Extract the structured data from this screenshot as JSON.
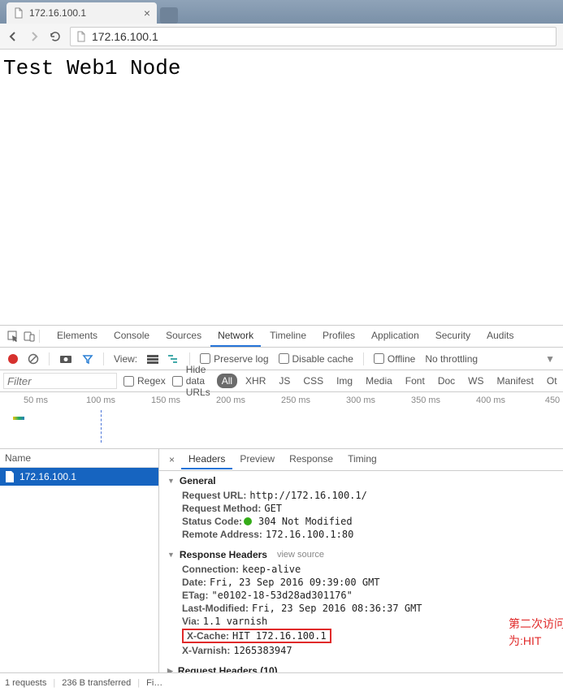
{
  "browser": {
    "tab_title": "172.16.100.1",
    "url_display": "172.16.100.1"
  },
  "page": {
    "body_text": "Test Web1 Node"
  },
  "devtools": {
    "tabs": [
      "Elements",
      "Console",
      "Sources",
      "Network",
      "Timeline",
      "Profiles",
      "Application",
      "Security",
      "Audits"
    ],
    "active_tab_index": 3,
    "toolbar": {
      "view_label": "View:",
      "preserve_log": "Preserve log",
      "disable_cache": "Disable cache",
      "offline": "Offline",
      "throttling": "No throttling"
    },
    "filter": {
      "placeholder": "Filter",
      "regex": "Regex",
      "hide_data_urls": "Hide data URLs",
      "types": [
        "All",
        "XHR",
        "JS",
        "CSS",
        "Img",
        "Media",
        "Font",
        "Doc",
        "WS",
        "Manifest",
        "Ot"
      ],
      "active_type_index": 0
    },
    "timeline_ticks": [
      "50 ms",
      "100 ms",
      "150 ms",
      "200 ms",
      "250 ms",
      "300 ms",
      "350 ms",
      "400 ms",
      "450"
    ],
    "request_list": {
      "header": "Name",
      "items": [
        "172.16.100.1"
      ]
    },
    "detail_tabs": [
      "Headers",
      "Preview",
      "Response",
      "Timing"
    ],
    "active_detail_tab_index": 0,
    "headers": {
      "general": {
        "title": "General",
        "request_url_k": "Request URL:",
        "request_url_v": "http://172.16.100.1/",
        "request_method_k": "Request Method:",
        "request_method_v": "GET",
        "status_code_k": "Status Code:",
        "status_code_v": "304 Not Modified",
        "remote_address_k": "Remote Address:",
        "remote_address_v": "172.16.100.1:80"
      },
      "response": {
        "title": "Response Headers",
        "view_source": "view source",
        "items": [
          {
            "k": "Connection:",
            "v": "keep-alive"
          },
          {
            "k": "Date:",
            "v": "Fri, 23 Sep 2016 09:39:00 GMT"
          },
          {
            "k": "ETag:",
            "v": "\"e0102-18-53d28ad301176\""
          },
          {
            "k": "Last-Modified:",
            "v": "Fri, 23 Sep 2016 08:36:37 GMT"
          },
          {
            "k": "Via:",
            "v": "1.1 varnish"
          },
          {
            "k": "X-Cache:",
            "v": "HIT 172.16.100.1",
            "highlight": true
          },
          {
            "k": "X-Varnish:",
            "v": "1265383947"
          }
        ]
      },
      "request": {
        "title": "Request Headers (10)"
      }
    },
    "annotation": "第二次访问命中缓存，显示自定义信息为:HIT",
    "status_bar": {
      "requests": "1 requests",
      "transferred": "236 B transferred",
      "finish": "Fi…"
    }
  }
}
